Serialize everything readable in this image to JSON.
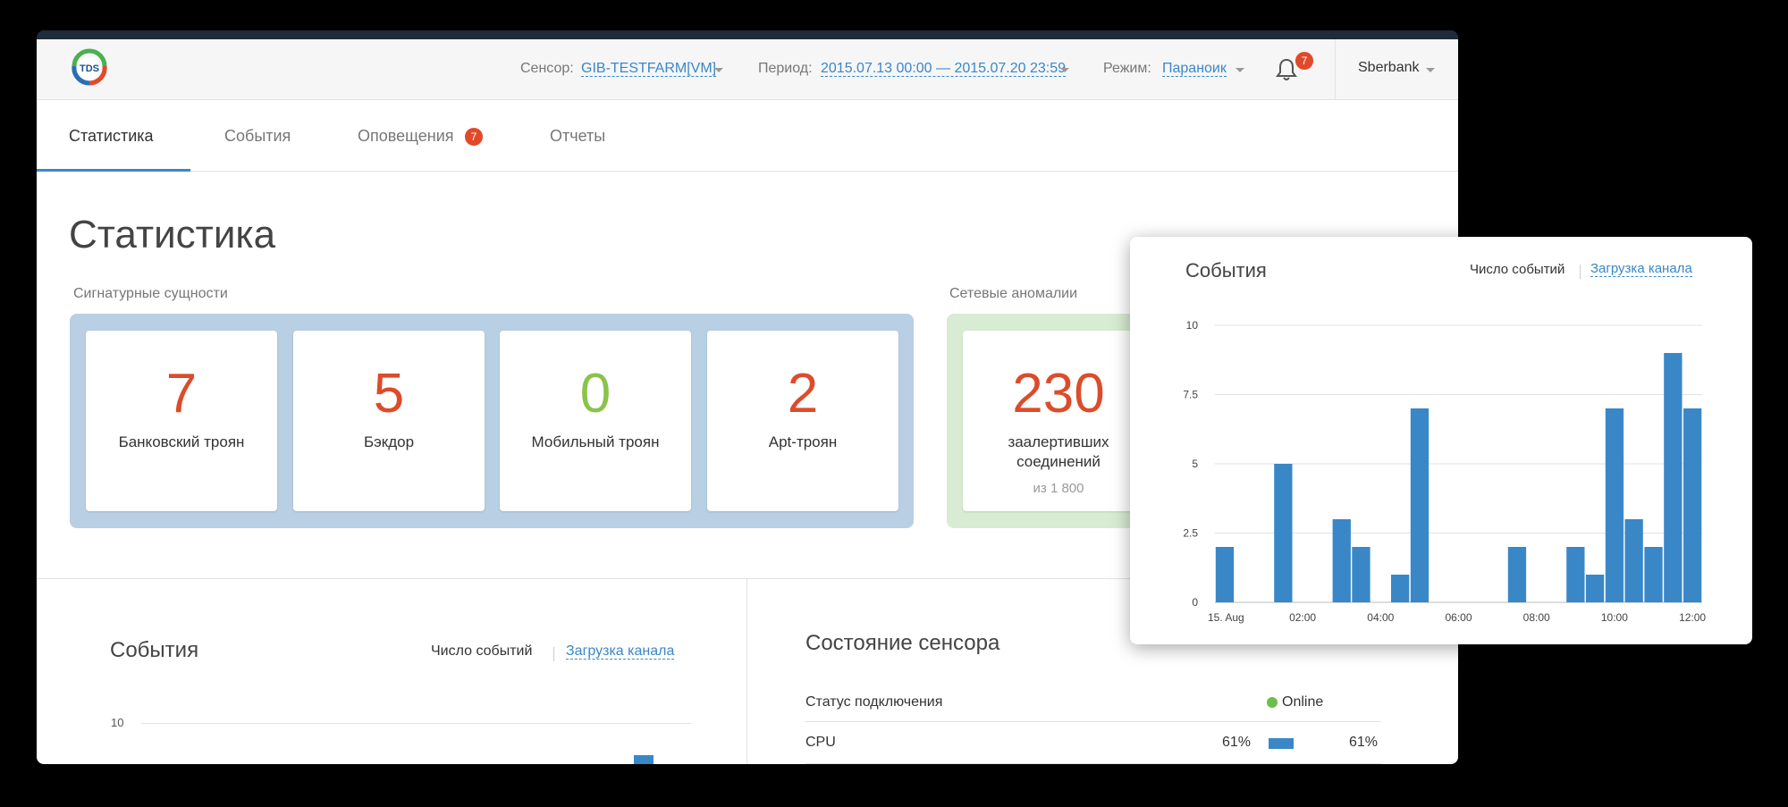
{
  "header": {
    "logo_text": "TDS",
    "sensor_label": "Сенсор:",
    "sensor_value": "GIB-TESTFARM[VM]",
    "period_label": "Период:",
    "period_value": "2015.07.13 00:00 — 2015.07.20 23:59",
    "mode_label": "Режим:",
    "mode_value": "Параноик",
    "notifications_count": "7",
    "account": "Sberbank"
  },
  "tabs": [
    {
      "label": "Статистика"
    },
    {
      "label": "События"
    },
    {
      "label": "Оповещения"
    },
    {
      "label": "Отчеты"
    }
  ],
  "tabs_badge": "7",
  "page_title": "Статистика",
  "signature_section": {
    "label": "Сигнатурные сущности",
    "cards": [
      {
        "value": "7",
        "label": "Банковский троян"
      },
      {
        "value": "5",
        "label": "Бэкдор"
      },
      {
        "value": "0",
        "label": "Мобильный троян"
      },
      {
        "value": "2",
        "label": "Apt-троян"
      }
    ]
  },
  "anomaly_section": {
    "label": "Сетевые аномалии",
    "card": {
      "value": "230",
      "label": "заалертивших соединений",
      "sub": "из 1 800"
    }
  },
  "events_bottom": {
    "title": "События",
    "tab_count": "Число событий",
    "tab_load": "Загрузка канала",
    "ytick": "10"
  },
  "sensor_state": {
    "title": "Состояние сенсора",
    "connection_label": "Статус подключения",
    "connection_value": "Online",
    "cpu_label": "CPU",
    "cpu_value": "61%",
    "cpu_value2": "61%"
  },
  "chart_card": {
    "title": "События",
    "tab_count": "Число событий",
    "tab_load": "Загрузка канала"
  },
  "colors": {
    "accent": "#3a87c8",
    "danger": "#dc4c2b",
    "success": "#8bc34a"
  },
  "chart_data": {
    "type": "bar",
    "title": "События",
    "xlabel": "",
    "ylabel": "",
    "ylim": [
      0,
      10
    ],
    "yticks": [
      0,
      2.5,
      5,
      7.5,
      10
    ],
    "yticks_labels": [
      "0",
      "2.5",
      "5",
      "7.5",
      "10"
    ],
    "xticks": [
      "15. Aug",
      "02:00",
      "04:00",
      "06:00",
      "08:00",
      "10:00",
      "12:00"
    ],
    "values": [
      2,
      0,
      0,
      5,
      0,
      0,
      3,
      2,
      0,
      1,
      7,
      0,
      0,
      0,
      0,
      2,
      0,
      0,
      2,
      1,
      7,
      3,
      2,
      9,
      7
    ],
    "grid": true
  }
}
